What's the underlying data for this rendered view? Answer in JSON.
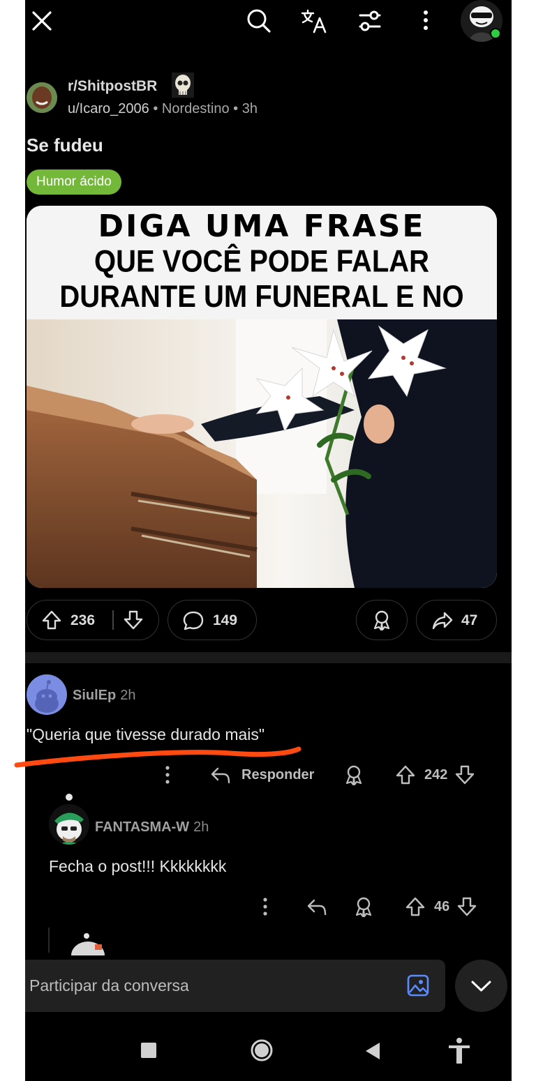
{
  "topbar": {
    "close_icon": "close-icon",
    "search_icon": "search-icon",
    "translate_icon": "translate-icon",
    "filter_icon": "filter-icon",
    "more_icon": "more-vertical-icon",
    "avatar_icon": "user-avatar"
  },
  "post": {
    "subreddit": "r/ShitpostBR",
    "author": "u/Icaro_2006",
    "author_flair": "Nordestino",
    "age": "3h",
    "title": "Se fudeu",
    "flair": "Humor ácido",
    "meme_text": {
      "line1": "DIGA UMA FRASE",
      "line2": "QUE VOCÊ PODE FALAR",
      "line3": "DURANTE UM FUNERAL E NO SEXO"
    },
    "upvotes": "236",
    "comments": "149",
    "shares": "47"
  },
  "comments": [
    {
      "author": "SiulEp",
      "age": "2h",
      "body": "\"Queria que tivesse durado mais\"",
      "reply_label": "Responder",
      "votes": "242"
    },
    {
      "author": "FANTASMA-W",
      "age": "2h",
      "body": "Fecha o post!!! Kkkkkkkk",
      "votes": "46"
    }
  ],
  "composer": {
    "placeholder": "Participar da conversa",
    "image_icon": "image-icon",
    "collapse_icon": "chevron-down-icon"
  },
  "navbar": {
    "recents_icon": "square-icon",
    "home_icon": "circle-icon",
    "back_icon": "triangle-back-icon",
    "accessibility_icon": "accessibility-icon"
  },
  "colors": {
    "background": "#000000",
    "flair": "#74b83a",
    "annotation": "#ff4a12",
    "online": "#2ecc40",
    "image_icon": "#5b8cff"
  }
}
